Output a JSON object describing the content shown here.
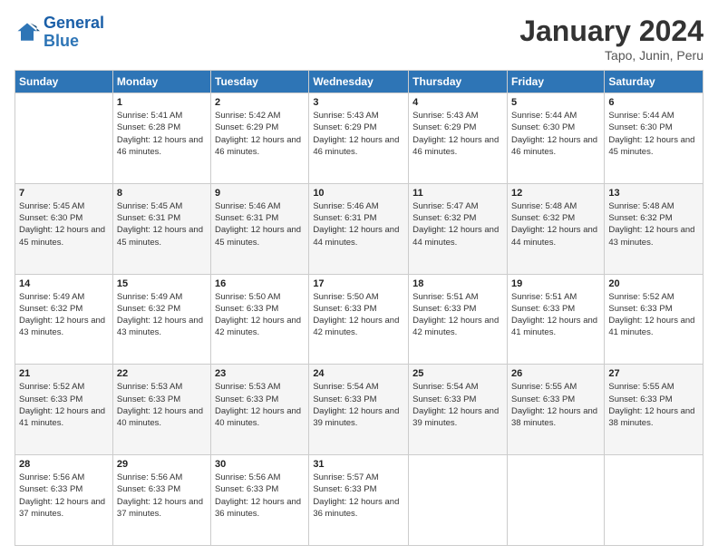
{
  "logo": {
    "line1": "General",
    "line2": "Blue"
  },
  "title": {
    "month_year": "January 2024",
    "location": "Tapo, Junin, Peru"
  },
  "days_of_week": [
    "Sunday",
    "Monday",
    "Tuesday",
    "Wednesday",
    "Thursday",
    "Friday",
    "Saturday"
  ],
  "weeks": [
    [
      {
        "day": "",
        "sunrise": "",
        "sunset": "",
        "daylight": ""
      },
      {
        "day": "1",
        "sunrise": "Sunrise: 5:41 AM",
        "sunset": "Sunset: 6:28 PM",
        "daylight": "Daylight: 12 hours and 46 minutes."
      },
      {
        "day": "2",
        "sunrise": "Sunrise: 5:42 AM",
        "sunset": "Sunset: 6:29 PM",
        "daylight": "Daylight: 12 hours and 46 minutes."
      },
      {
        "day": "3",
        "sunrise": "Sunrise: 5:43 AM",
        "sunset": "Sunset: 6:29 PM",
        "daylight": "Daylight: 12 hours and 46 minutes."
      },
      {
        "day": "4",
        "sunrise": "Sunrise: 5:43 AM",
        "sunset": "Sunset: 6:29 PM",
        "daylight": "Daylight: 12 hours and 46 minutes."
      },
      {
        "day": "5",
        "sunrise": "Sunrise: 5:44 AM",
        "sunset": "Sunset: 6:30 PM",
        "daylight": "Daylight: 12 hours and 46 minutes."
      },
      {
        "day": "6",
        "sunrise": "Sunrise: 5:44 AM",
        "sunset": "Sunset: 6:30 PM",
        "daylight": "Daylight: 12 hours and 45 minutes."
      }
    ],
    [
      {
        "day": "7",
        "sunrise": "Sunrise: 5:45 AM",
        "sunset": "Sunset: 6:30 PM",
        "daylight": "Daylight: 12 hours and 45 minutes."
      },
      {
        "day": "8",
        "sunrise": "Sunrise: 5:45 AM",
        "sunset": "Sunset: 6:31 PM",
        "daylight": "Daylight: 12 hours and 45 minutes."
      },
      {
        "day": "9",
        "sunrise": "Sunrise: 5:46 AM",
        "sunset": "Sunset: 6:31 PM",
        "daylight": "Daylight: 12 hours and 45 minutes."
      },
      {
        "day": "10",
        "sunrise": "Sunrise: 5:46 AM",
        "sunset": "Sunset: 6:31 PM",
        "daylight": "Daylight: 12 hours and 44 minutes."
      },
      {
        "day": "11",
        "sunrise": "Sunrise: 5:47 AM",
        "sunset": "Sunset: 6:32 PM",
        "daylight": "Daylight: 12 hours and 44 minutes."
      },
      {
        "day": "12",
        "sunrise": "Sunrise: 5:48 AM",
        "sunset": "Sunset: 6:32 PM",
        "daylight": "Daylight: 12 hours and 44 minutes."
      },
      {
        "day": "13",
        "sunrise": "Sunrise: 5:48 AM",
        "sunset": "Sunset: 6:32 PM",
        "daylight": "Daylight: 12 hours and 43 minutes."
      }
    ],
    [
      {
        "day": "14",
        "sunrise": "Sunrise: 5:49 AM",
        "sunset": "Sunset: 6:32 PM",
        "daylight": "Daylight: 12 hours and 43 minutes."
      },
      {
        "day": "15",
        "sunrise": "Sunrise: 5:49 AM",
        "sunset": "Sunset: 6:32 PM",
        "daylight": "Daylight: 12 hours and 43 minutes."
      },
      {
        "day": "16",
        "sunrise": "Sunrise: 5:50 AM",
        "sunset": "Sunset: 6:33 PM",
        "daylight": "Daylight: 12 hours and 42 minutes."
      },
      {
        "day": "17",
        "sunrise": "Sunrise: 5:50 AM",
        "sunset": "Sunset: 6:33 PM",
        "daylight": "Daylight: 12 hours and 42 minutes."
      },
      {
        "day": "18",
        "sunrise": "Sunrise: 5:51 AM",
        "sunset": "Sunset: 6:33 PM",
        "daylight": "Daylight: 12 hours and 42 minutes."
      },
      {
        "day": "19",
        "sunrise": "Sunrise: 5:51 AM",
        "sunset": "Sunset: 6:33 PM",
        "daylight": "Daylight: 12 hours and 41 minutes."
      },
      {
        "day": "20",
        "sunrise": "Sunrise: 5:52 AM",
        "sunset": "Sunset: 6:33 PM",
        "daylight": "Daylight: 12 hours and 41 minutes."
      }
    ],
    [
      {
        "day": "21",
        "sunrise": "Sunrise: 5:52 AM",
        "sunset": "Sunset: 6:33 PM",
        "daylight": "Daylight: 12 hours and 41 minutes."
      },
      {
        "day": "22",
        "sunrise": "Sunrise: 5:53 AM",
        "sunset": "Sunset: 6:33 PM",
        "daylight": "Daylight: 12 hours and 40 minutes."
      },
      {
        "day": "23",
        "sunrise": "Sunrise: 5:53 AM",
        "sunset": "Sunset: 6:33 PM",
        "daylight": "Daylight: 12 hours and 40 minutes."
      },
      {
        "day": "24",
        "sunrise": "Sunrise: 5:54 AM",
        "sunset": "Sunset: 6:33 PM",
        "daylight": "Daylight: 12 hours and 39 minutes."
      },
      {
        "day": "25",
        "sunrise": "Sunrise: 5:54 AM",
        "sunset": "Sunset: 6:33 PM",
        "daylight": "Daylight: 12 hours and 39 minutes."
      },
      {
        "day": "26",
        "sunrise": "Sunrise: 5:55 AM",
        "sunset": "Sunset: 6:33 PM",
        "daylight": "Daylight: 12 hours and 38 minutes."
      },
      {
        "day": "27",
        "sunrise": "Sunrise: 5:55 AM",
        "sunset": "Sunset: 6:33 PM",
        "daylight": "Daylight: 12 hours and 38 minutes."
      }
    ],
    [
      {
        "day": "28",
        "sunrise": "Sunrise: 5:56 AM",
        "sunset": "Sunset: 6:33 PM",
        "daylight": "Daylight: 12 hours and 37 minutes."
      },
      {
        "day": "29",
        "sunrise": "Sunrise: 5:56 AM",
        "sunset": "Sunset: 6:33 PM",
        "daylight": "Daylight: 12 hours and 37 minutes."
      },
      {
        "day": "30",
        "sunrise": "Sunrise: 5:56 AM",
        "sunset": "Sunset: 6:33 PM",
        "daylight": "Daylight: 12 hours and 36 minutes."
      },
      {
        "day": "31",
        "sunrise": "Sunrise: 5:57 AM",
        "sunset": "Sunset: 6:33 PM",
        "daylight": "Daylight: 12 hours and 36 minutes."
      },
      {
        "day": "",
        "sunrise": "",
        "sunset": "",
        "daylight": ""
      },
      {
        "day": "",
        "sunrise": "",
        "sunset": "",
        "daylight": ""
      },
      {
        "day": "",
        "sunrise": "",
        "sunset": "",
        "daylight": ""
      }
    ]
  ]
}
